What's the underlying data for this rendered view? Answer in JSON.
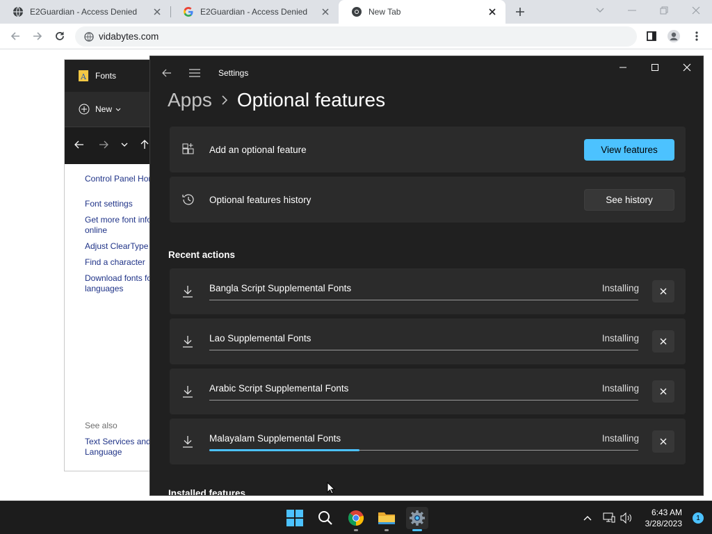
{
  "browser": {
    "tabs": [
      {
        "title": "E2Guardian - Access Denied",
        "icon": "globe-favicon"
      },
      {
        "title": "E2Guardian - Access Denied",
        "icon": "google-favicon"
      },
      {
        "title": "New Tab",
        "icon": "chrome-favicon"
      }
    ],
    "address": "vidabytes.com"
  },
  "fonts_window": {
    "title": "Fonts",
    "new_label": "New",
    "links": {
      "control_panel_home": "Control Panel Home",
      "font_settings": "Font settings",
      "get_more_line1": "Get more font information",
      "get_more_line2": "online",
      "adjust_cleartype": "Adjust ClearType text",
      "find_character": "Find a character",
      "download_line1": "Download fonts for all",
      "download_line2": "languages",
      "see_also": "See also",
      "text_services_line1": "Text Services and Input",
      "text_services_line2": "Language"
    }
  },
  "settings": {
    "window_title": "Settings",
    "breadcrumb": {
      "parent": "Apps",
      "current": "Optional features"
    },
    "add_feature": {
      "label": "Add an optional feature",
      "button": "View features"
    },
    "history": {
      "label": "Optional features history",
      "button": "See history"
    },
    "recent_header": "Recent actions",
    "actions": [
      {
        "name": "Bangla Script Supplemental Fonts",
        "status": "Installing",
        "progress": 0
      },
      {
        "name": "Lao Supplemental Fonts",
        "status": "Installing",
        "progress": 0
      },
      {
        "name": "Arabic Script Supplemental Fonts",
        "status": "Installing",
        "progress": 0
      },
      {
        "name": "Malayalam Supplemental Fonts",
        "status": "Installing",
        "progress": 0.35
      }
    ],
    "installed_header": "Installed features",
    "accent_color": "#4cc2ff"
  },
  "taskbar": {
    "time": "6:43 AM",
    "date": "3/28/2023",
    "notification_count": "1"
  }
}
